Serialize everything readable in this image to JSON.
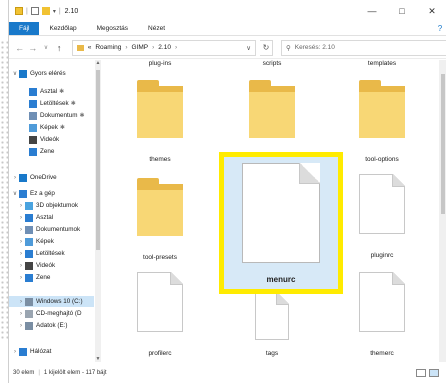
{
  "window": {
    "title": "2.10",
    "controls": [
      "—",
      "□",
      "✕"
    ]
  },
  "ribbon": {
    "tabs": [
      "Fájl",
      "Kezdőlap",
      "Megosztás",
      "Nézet"
    ],
    "help": "?"
  },
  "address": {
    "path": [
      "Roaming",
      "GIMP",
      "2.10"
    ],
    "prefix": "«",
    "search_placeholder": "Keresés: 2.10"
  },
  "nav_pane": {
    "items": [
      {
        "label": "Gyors elérés",
        "icon": "star-icon",
        "color": "#1979ca",
        "expand": "∨",
        "pinned": false
      },
      {
        "label": "Asztal",
        "icon": "desktop-icon",
        "color": "#2a7dd1",
        "pinned": true
      },
      {
        "label": "Letöltések",
        "icon": "download-icon",
        "color": "#2a7dd1",
        "pinned": true
      },
      {
        "label": "Dokumentum",
        "icon": "document-icon",
        "color": "#6f8fb5",
        "pinned": true
      },
      {
        "label": "Képek",
        "icon": "pictures-icon",
        "color": "#4f9bd9",
        "pinned": true
      },
      {
        "label": "Videók",
        "icon": "video-icon",
        "color": "#444444",
        "pinned": false
      },
      {
        "label": "Zene",
        "icon": "music-icon",
        "color": "#2a7dd1",
        "pinned": false
      },
      {
        "label": "OneDrive",
        "icon": "cloud-icon",
        "color": "#1979ca",
        "expand": "›",
        "pinned": false
      },
      {
        "label": "Ez a gép",
        "icon": "computer-icon",
        "color": "#2a7dd1",
        "expand": "∨",
        "pinned": false
      },
      {
        "label": "3D objektumok",
        "icon": "cube-icon",
        "color": "#4aa3df",
        "expand": "›",
        "pinned": false
      },
      {
        "label": "Asztal",
        "icon": "desktop-icon",
        "color": "#2a7dd1",
        "expand": "›",
        "pinned": false
      },
      {
        "label": "Dokumentumok",
        "icon": "document-icon",
        "color": "#6f8fb5",
        "expand": "›",
        "pinned": false
      },
      {
        "label": "Képek",
        "icon": "pictures-icon",
        "color": "#4f9bd9",
        "expand": "›",
        "pinned": false
      },
      {
        "label": "Letöltések",
        "icon": "download-icon",
        "color": "#2a7dd1",
        "expand": "›",
        "pinned": false
      },
      {
        "label": "Videók",
        "icon": "video-icon",
        "color": "#444444",
        "expand": "›",
        "pinned": false
      },
      {
        "label": "Zene",
        "icon": "music-icon",
        "color": "#2a7dd1",
        "expand": "›",
        "pinned": false
      },
      {
        "label": "Windows 10 (C:)",
        "icon": "drive-icon",
        "color": "#7a8ea3",
        "expand": "›",
        "pinned": false,
        "selected": true
      },
      {
        "label": "CD-meghajtó (D",
        "icon": "cd-icon",
        "color": "#9aa5b1",
        "expand": "›",
        "pinned": false
      },
      {
        "label": "Adatok (E:)",
        "icon": "drive-icon",
        "color": "#7a8ea3",
        "expand": "›",
        "pinned": false
      },
      {
        "label": "Hálózat",
        "icon": "network-icon",
        "color": "#2a7dd1",
        "expand": "›",
        "pinned": false
      }
    ]
  },
  "content": {
    "top_labels": [
      "plug-ins",
      "scripts",
      "templates"
    ],
    "items": [
      {
        "name": "themes",
        "kind": "folder"
      },
      {
        "name": "",
        "kind": "folder"
      },
      {
        "name": "tool-options",
        "kind": "folder"
      },
      {
        "name": "tool-presets",
        "kind": "folder"
      },
      {
        "name": "pluginrc",
        "kind": "file"
      },
      {
        "name": "profilerc",
        "kind": "file"
      },
      {
        "name": "tags",
        "kind": "xml"
      },
      {
        "name": "themerc",
        "kind": "file"
      }
    ],
    "selected": {
      "name": "menurc",
      "highlight_color": "#ffeb00",
      "selection_bg": "#d7e9f7"
    }
  },
  "status": {
    "count": "30 elem",
    "selection": "1 kijelölt elem - 117 bájt"
  },
  "colors": {
    "accent": "#1979ca",
    "folder": "#f8d775",
    "folder_back": "#e9b949"
  }
}
